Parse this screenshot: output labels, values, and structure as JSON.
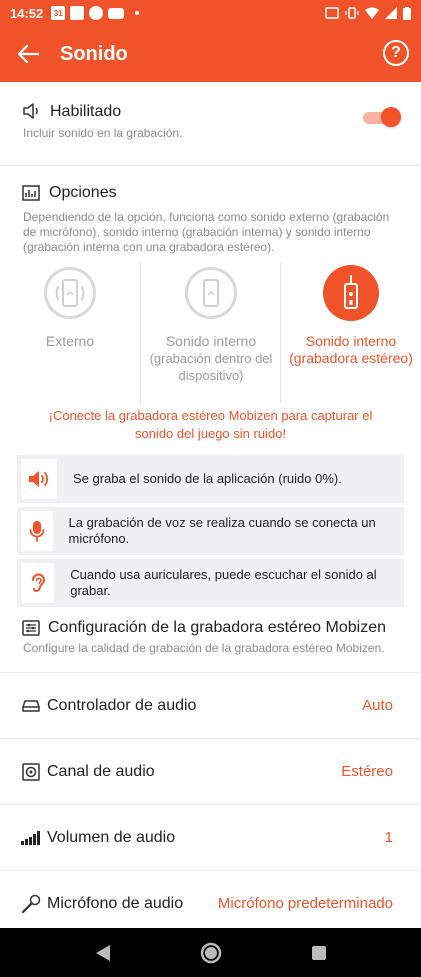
{
  "status_bar": {
    "time": "14:52",
    "calendar_day": "31"
  },
  "app_bar": {
    "title": "Sonido",
    "help_label": "?"
  },
  "enabled": {
    "title": "Habilitado",
    "description": "Incluir sonido en la grabación.",
    "toggle_on": true
  },
  "options": {
    "title": "Opciones",
    "description": "Dependiendo de la opción, funciona como sonido externo (grabación de micrófono), sonido interno (grabación interna) y sonido interno (grabación interna con una grabadora estéreo).",
    "modes": [
      {
        "label": "Externo",
        "sublabel": "",
        "selected": false
      },
      {
        "label": "Sonido interno",
        "sublabel": "(grabación dentro del dispositivo)",
        "selected": false
      },
      {
        "label": "Sonido interno",
        "sublabel": "(grabadora estéreo)",
        "selected": true
      }
    ],
    "notice": "¡Conecte la grabadora estéreo Mobizen para capturar el sonido del juego sin ruido!"
  },
  "info_rows": [
    {
      "icon": "speaker-icon",
      "text": "Se graba el sonido de la aplicación (ruido 0%)."
    },
    {
      "icon": "microphone-icon",
      "text": "La grabación de voz se realiza cuando se conecta un micrófono."
    },
    {
      "icon": "ear-icon",
      "text": "Cuando usa auriculares, puede escuchar el sonido al grabar."
    }
  ],
  "stereo_config": {
    "title": "Configuración de la grabadora estéreo Mobizen",
    "description": "Configure la calidad de grabación de la grabadora estéreo Mobizen."
  },
  "settings": [
    {
      "label": "Controlador de audio",
      "value": "Auto"
    },
    {
      "label": "Canal de audio",
      "value": "Estéreo"
    },
    {
      "label": "Volumen de audio",
      "value": "1"
    },
    {
      "label": "Micrófono de audio",
      "value": "Micrófono predeterminado"
    }
  ],
  "colors": {
    "accent": "#f0532a",
    "muted": "#8a8a8a",
    "info_bg": "#eef0f2"
  }
}
